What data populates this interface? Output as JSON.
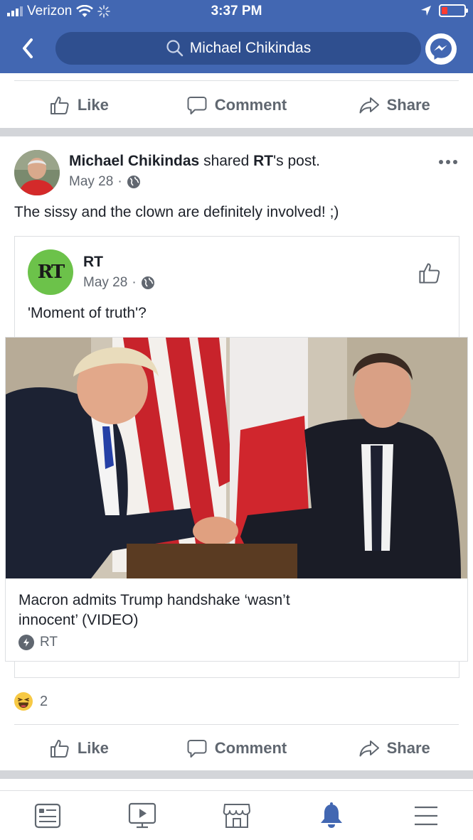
{
  "status_bar": {
    "carrier": "Verizon",
    "time": "3:37 PM"
  },
  "header": {
    "search_text": "Michael Chikindas"
  },
  "action_bar": {
    "like_label": "Like",
    "comment_label": "Comment",
    "share_label": "Share"
  },
  "post": {
    "author": "Michael Chikindas",
    "shared_text": "shared",
    "shared_source": "RT",
    "shared_suffix": "'s post.",
    "date": "May 28",
    "dot": "·",
    "text": "The sissy and the clown are definitely involved! ;)",
    "shared_post": {
      "page_name": "RT",
      "logo_text": "RT",
      "date": "May 28",
      "dot": "·",
      "text": "'Moment of truth'?",
      "link": {
        "title": "Macron admits Trump handshake ‘wasn’t innocent’ (VIDEO)",
        "source": "RT"
      }
    },
    "reactions": {
      "type_icon": "haha-emoji-icon",
      "count": "2"
    }
  },
  "tab_bar": {
    "items": [
      "news-feed-icon",
      "watch-icon",
      "marketplace-icon",
      "notifications-icon",
      "menu-icon"
    ],
    "active_color": "#4267b2",
    "inactive_color": "#606770"
  },
  "colors": {
    "brand_blue": "#4267b2",
    "rt_green": "#6cc24a"
  }
}
